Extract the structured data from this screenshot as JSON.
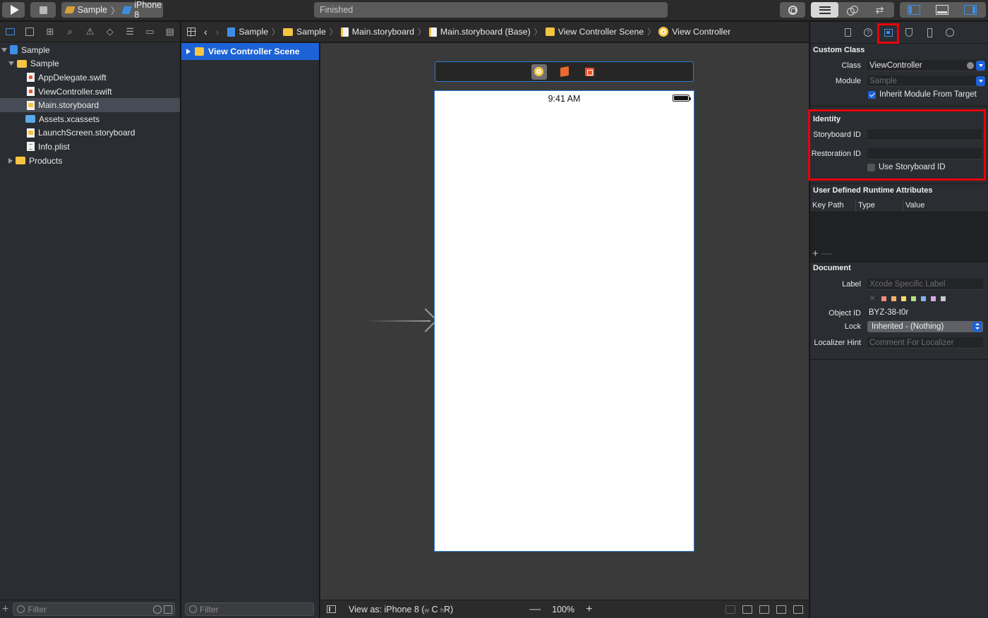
{
  "toolbar": {
    "scheme": "Sample",
    "device": "iPhone 8",
    "activity_status": "Finished"
  },
  "navigator": {
    "items": [
      {
        "label": "Sample"
      },
      {
        "label": "Sample"
      },
      {
        "label": "AppDelegate.swift"
      },
      {
        "label": "ViewController.swift"
      },
      {
        "label": "Main.storyboard"
      },
      {
        "label": "Assets.xcassets"
      },
      {
        "label": "LaunchScreen.storyboard"
      },
      {
        "label": "Info.plist"
      },
      {
        "label": "Products"
      }
    ],
    "filter_placeholder": "Filter"
  },
  "jumpbar": {
    "crumbs": [
      "Sample",
      "Sample",
      "Main.storyboard",
      "Main.storyboard (Base)",
      "View Controller Scene",
      "View Controller"
    ]
  },
  "outline": {
    "scene": "View Controller Scene",
    "filter_placeholder": "Filter"
  },
  "canvas": {
    "status_time": "9:41 AM",
    "view_as": "View as: iPhone 8",
    "size_class_w": "w",
    "size_class_c": "C",
    "size_class_h": "h",
    "size_class_r": "R",
    "zoom": "100%"
  },
  "inspector": {
    "custom_class": {
      "title": "Custom Class",
      "class_label": "Class",
      "class_value": "ViewController",
      "module_label": "Module",
      "module_placeholder": "Sample",
      "inherit_label": "Inherit Module From Target"
    },
    "identity": {
      "title": "Identity",
      "storyboard_id_label": "Storyboard ID",
      "restoration_id_label": "Restoration ID",
      "use_storyboard_id_label": "Use Storyboard ID"
    },
    "runtime_attributes": {
      "title": "User Defined Runtime Attributes",
      "col_key_path": "Key Path",
      "col_type": "Type",
      "col_value": "Value"
    },
    "document": {
      "title": "Document",
      "label_label": "Label",
      "label_placeholder": "Xcode Specific Label",
      "object_id_label": "Object ID",
      "object_id_value": "BYZ-38-t0r",
      "lock_label": "Lock",
      "lock_value": "Inherited - (Nothing)",
      "localizer_label": "Localizer Hint",
      "localizer_placeholder": "Comment For Localizer"
    },
    "swatch_colors": [
      "#f08a7e",
      "#f6b26b",
      "#f5d76e",
      "#b5de7d",
      "#7fb3ee",
      "#d9a6e6",
      "#c8c8c8"
    ]
  }
}
